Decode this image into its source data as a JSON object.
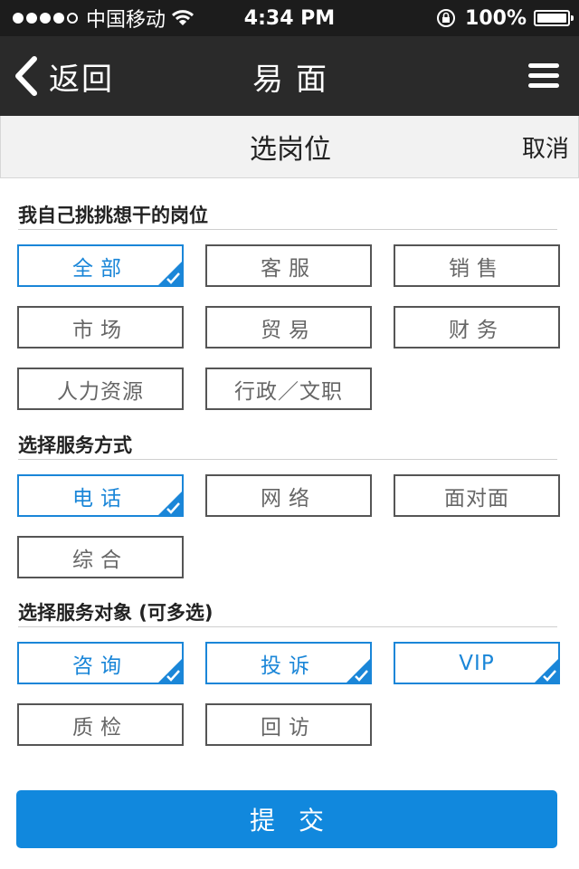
{
  "status": {
    "carrier": "中国移动",
    "time": "4:34 PM",
    "battery": "100%"
  },
  "nav": {
    "back_label": "返回",
    "title": "易面"
  },
  "subheader": {
    "title": "选岗位",
    "cancel": "取消"
  },
  "sections": {
    "positions": {
      "label": "我自己挑挑想干的岗位",
      "options": [
        {
          "label": "全部",
          "selected": true
        },
        {
          "label": "客服",
          "selected": false
        },
        {
          "label": "销售",
          "selected": false
        },
        {
          "label": "市场",
          "selected": false
        },
        {
          "label": "贸易",
          "selected": false
        },
        {
          "label": "财务",
          "selected": false
        },
        {
          "label": "人力资源",
          "selected": false
        },
        {
          "label": "行政／文职",
          "selected": false
        }
      ]
    },
    "service_mode": {
      "label": "选择服务方式",
      "options": [
        {
          "label": "电话",
          "selected": true
        },
        {
          "label": "网络",
          "selected": false
        },
        {
          "label": "面对面",
          "selected": false
        },
        {
          "label": "综合",
          "selected": false
        }
      ]
    },
    "service_target": {
      "label": "选择服务对象 (可多选)",
      "options": [
        {
          "label": "咨询",
          "selected": true
        },
        {
          "label": "投诉",
          "selected": true
        },
        {
          "label": "VIP",
          "selected": true
        },
        {
          "label": "质检",
          "selected": false
        },
        {
          "label": "回访",
          "selected": false
        }
      ]
    }
  },
  "submit_label": "提交",
  "colors": {
    "accent": "#1a86d8",
    "button": "#1188dd",
    "nav_bg": "#2a2a2a"
  }
}
